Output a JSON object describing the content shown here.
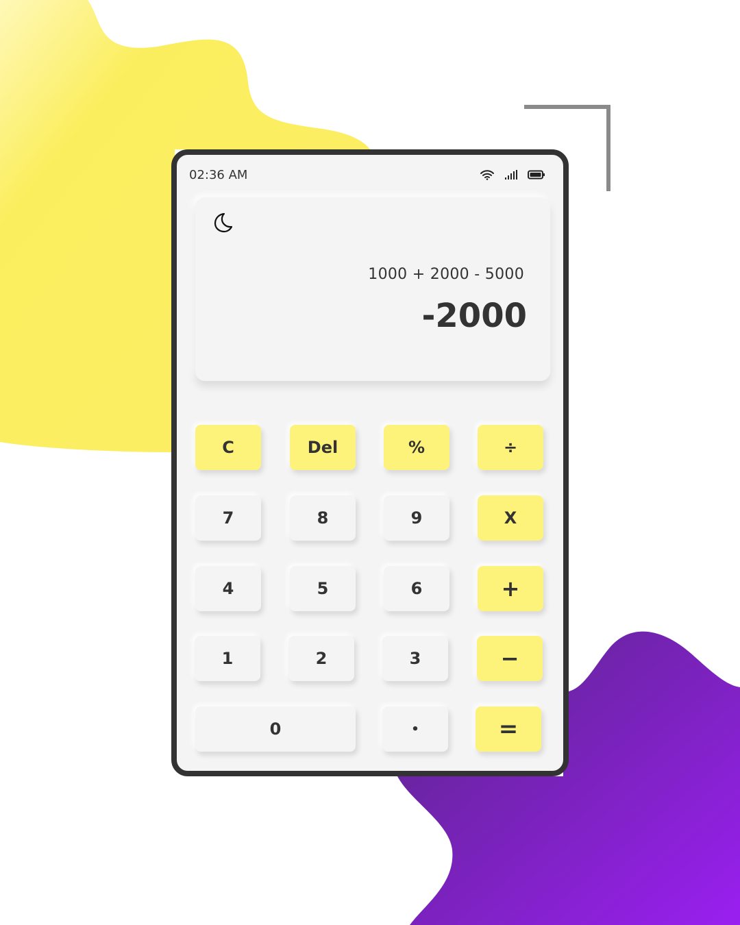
{
  "status_bar": {
    "time": "02:36 AM",
    "icons": [
      "wifi-icon",
      "signal-icon",
      "battery-icon"
    ]
  },
  "display": {
    "theme_icon": "moon-icon",
    "expression": "1000 + 2000 - 5000",
    "result": "-2000"
  },
  "keys": {
    "clear": "C",
    "delete": "Del",
    "percent": "%",
    "divide": "÷",
    "seven": "7",
    "eight": "8",
    "nine": "9",
    "multiply": "X",
    "four": "4",
    "five": "5",
    "six": "6",
    "plus": "+",
    "one": "1",
    "two": "2",
    "three": "3",
    "minus": "−",
    "zero": "0",
    "decimal": "•",
    "equals": "="
  },
  "colors": {
    "accent_yellow": "#fdf37a",
    "background_blob_yellow": "#fbee5e",
    "background_blob_purple": "#8a1fd6",
    "frame": "#333333",
    "surface": "#f4f4f4",
    "text": "#333333"
  }
}
